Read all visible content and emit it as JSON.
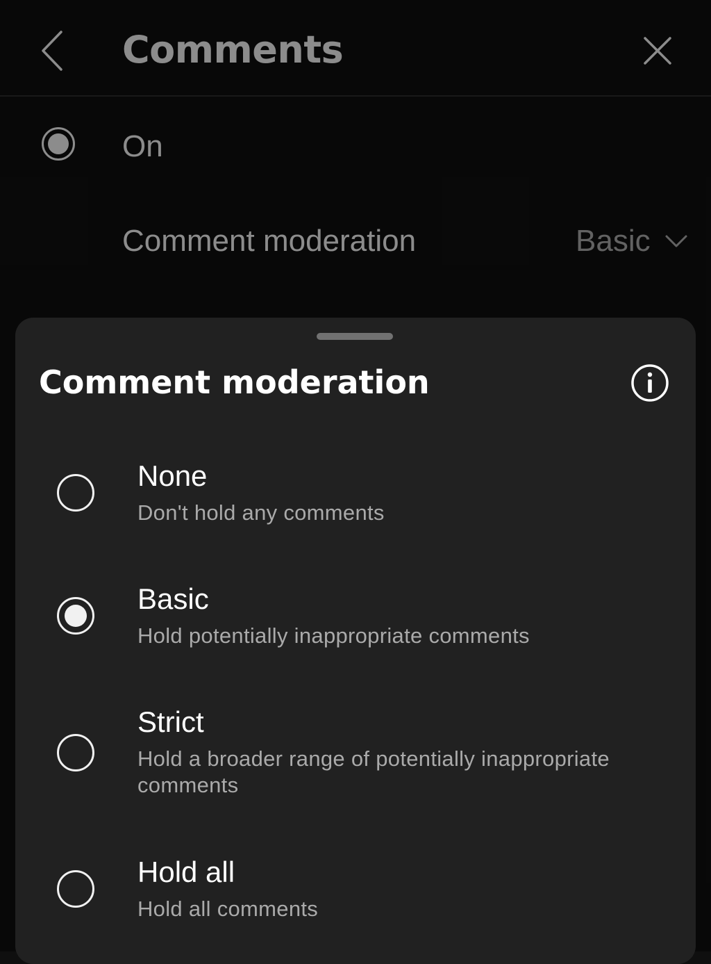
{
  "header": {
    "title": "Comments",
    "back_icon": "chevron-left-icon",
    "close_icon": "close-icon"
  },
  "on_row": {
    "label": "On",
    "selected": true
  },
  "moderation_row": {
    "label": "Comment moderation",
    "value": "Basic",
    "icon": "chevron-down-icon"
  },
  "sheet": {
    "title": "Comment moderation",
    "info_icon": "info-icon",
    "options": [
      {
        "title": "None",
        "description": "Don't hold any comments",
        "selected": false
      },
      {
        "title": "Basic",
        "description": "Hold potentially inappropriate comments",
        "selected": true
      },
      {
        "title": "Strict",
        "description": "Hold a broader range of potentially inappropriate comments",
        "selected": false
      },
      {
        "title": "Hold all",
        "description": "Hold all comments",
        "selected": false
      }
    ]
  },
  "colors": {
    "background": "#0f0f0f",
    "sheet": "#212121",
    "text_primary": "#f1f1f1",
    "text_secondary": "#aaaaaa"
  }
}
